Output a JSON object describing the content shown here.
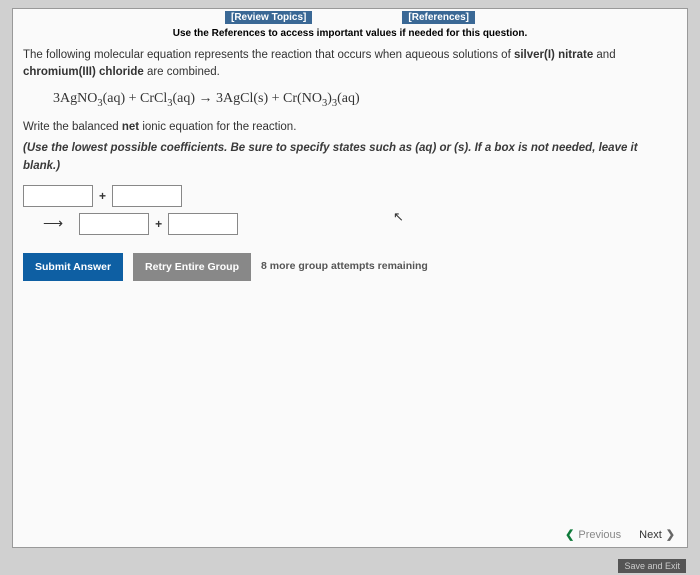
{
  "topLinks": {
    "review": "[Review Topics]",
    "references": "[References]"
  },
  "refHint": "Use the References to access important values if needed for this question.",
  "intro": {
    "part1": "The following molecular equation represents the reaction that occurs when aqueous solutions of ",
    "bold1": "silver(I) nitrate",
    "part2": " and ",
    "bold2": "chromium(III) chloride",
    "part3": " are combined."
  },
  "equation": "3AgNO₃(aq) + CrCl₃(aq) → 3AgCl(s) + Cr(NO₃)₃(aq)",
  "task": {
    "part1": "Write the balanced ",
    "bold": "net",
    "part2": " ionic equation for the reaction."
  },
  "hint": "(Use the lowest possible coefficients. Be sure to specify states such as (aq) or (s). If a box is not needed, leave it blank.)",
  "symbols": {
    "plus": "+",
    "arrow": "⟶"
  },
  "buttons": {
    "submit": "Submit Answer",
    "retry": "Retry Entire Group",
    "attempts": "8 more group attempts remaining"
  },
  "nav": {
    "previous": "Previous",
    "next": "Next"
  },
  "saveExit": "Save and Exit"
}
